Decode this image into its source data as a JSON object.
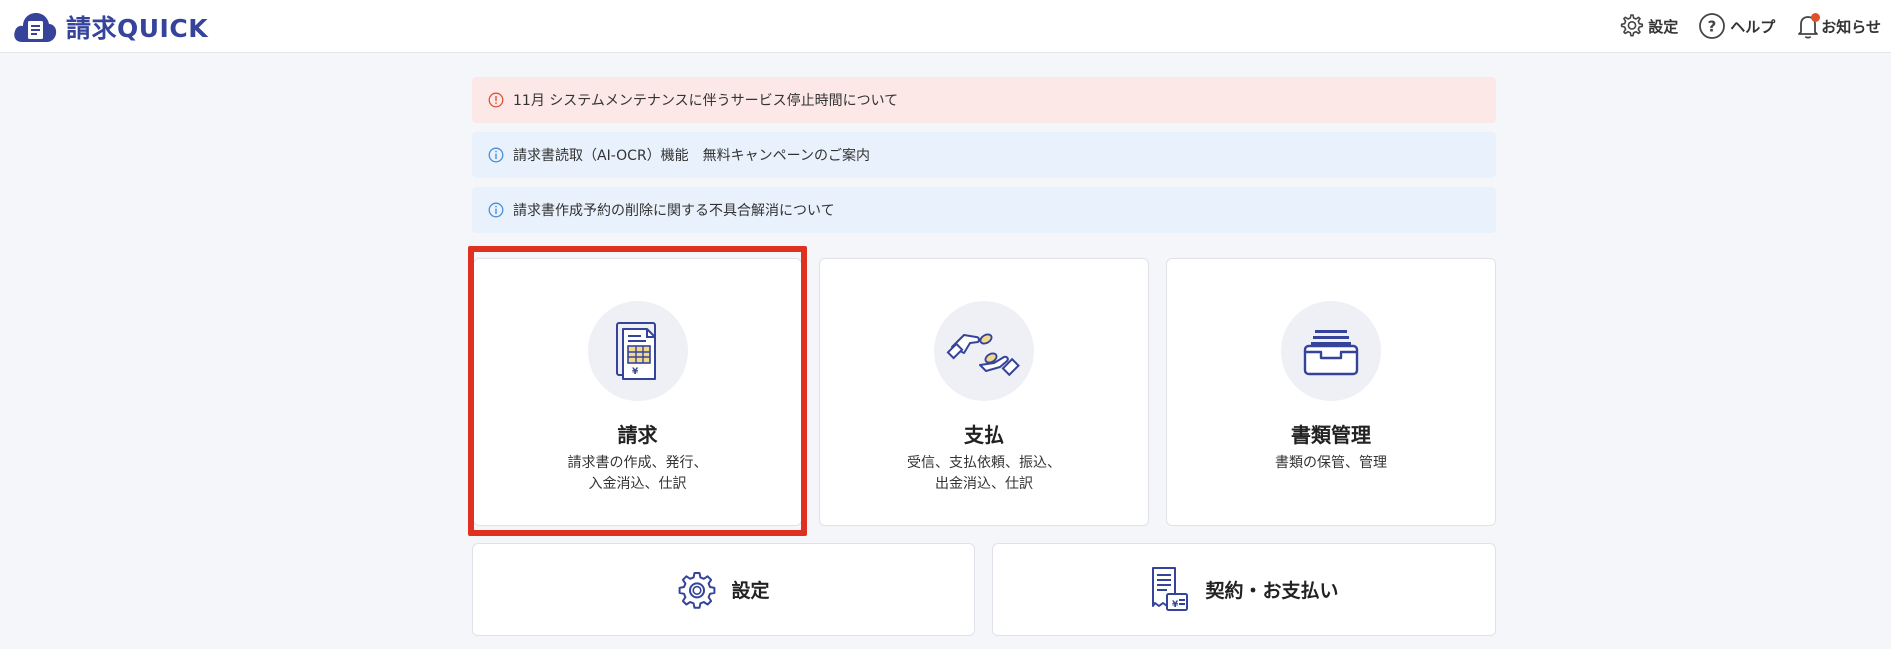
{
  "header": {
    "app_name": "請求QUICK",
    "settings_label": "設定",
    "help_label": "ヘルプ",
    "notifications_label": "お知らせ"
  },
  "notices": [
    {
      "type": "warning",
      "text": "11月 システムメンテナンスに伴うサービス停止時間について"
    },
    {
      "type": "info",
      "text": "請求書読取（AI-OCR）機能　無料キャンペーンのご案内"
    },
    {
      "type": "info",
      "text": "請求書作成予約の削除に関する不具合解消について"
    }
  ],
  "cards": [
    {
      "title": "請求",
      "desc_lines": [
        "請求書の作成、発行、",
        "入金消込、仕訳"
      ],
      "icon": "invoice-icon",
      "selected": true
    },
    {
      "title": "支払",
      "desc_lines": [
        "受信、支払依頼、振込、",
        "出金消込、仕訳"
      ],
      "icon": "payment-hands-icon"
    },
    {
      "title": "書類管理",
      "desc_lines": [
        "書類の保管、管理"
      ],
      "icon": "document-tray-icon"
    }
  ],
  "bottom_buttons": [
    {
      "label": "設定",
      "icon": "gear-icon"
    },
    {
      "label": "契約・お支払い",
      "icon": "receipt-icon"
    }
  ],
  "colors": {
    "brand": "#35449a",
    "warning_bg": "#fce9e7",
    "info_bg": "#e9f2fc",
    "highlight": "#e0301f",
    "notification_dot": "#e0502b"
  }
}
